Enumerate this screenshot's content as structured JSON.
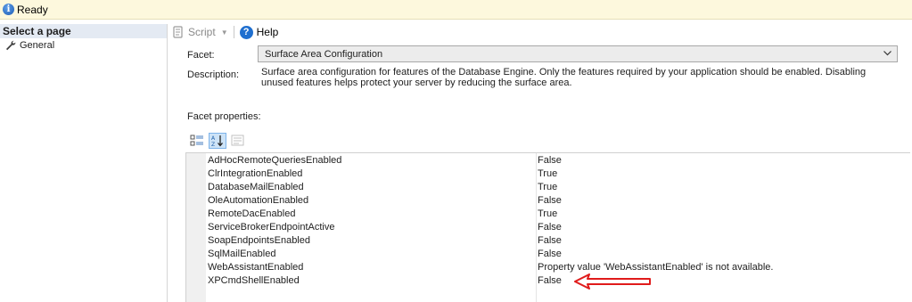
{
  "status": {
    "text": "Ready"
  },
  "sidebar": {
    "header": "Select a page",
    "items": [
      {
        "label": "General",
        "icon": "wrench-icon"
      }
    ]
  },
  "toolbar": {
    "script_label": "Script",
    "help_label": "Help"
  },
  "facet": {
    "label": "Facet:",
    "value": "Surface Area Configuration"
  },
  "description": {
    "label": "Description:",
    "text": "Surface area configuration for features of the Database Engine. Only the features required by your application should be enabled. Disabling unused features helps protect your server by reducing the surface area."
  },
  "facet_properties": {
    "label": "Facet properties:",
    "rows": [
      {
        "name": "AdHocRemoteQueriesEnabled",
        "value": "False"
      },
      {
        "name": "ClrIntegrationEnabled",
        "value": "True"
      },
      {
        "name": "DatabaseMailEnabled",
        "value": "True"
      },
      {
        "name": "OleAutomationEnabled",
        "value": "False"
      },
      {
        "name": "RemoteDacEnabled",
        "value": "True"
      },
      {
        "name": "ServiceBrokerEndpointActive",
        "value": "False"
      },
      {
        "name": "SoapEndpointsEnabled",
        "value": "False"
      },
      {
        "name": "SqlMailEnabled",
        "value": "False"
      },
      {
        "name": "WebAssistantEnabled",
        "value": "Property value 'WebAssistantEnabled' is not available."
      },
      {
        "name": "XPCmdShellEnabled",
        "value": "False"
      }
    ]
  },
  "colors": {
    "status_bg": "#fdf8dd",
    "sidebar_header_bg": "#e4eaf3",
    "annotation_arrow": "#e01b1b"
  }
}
